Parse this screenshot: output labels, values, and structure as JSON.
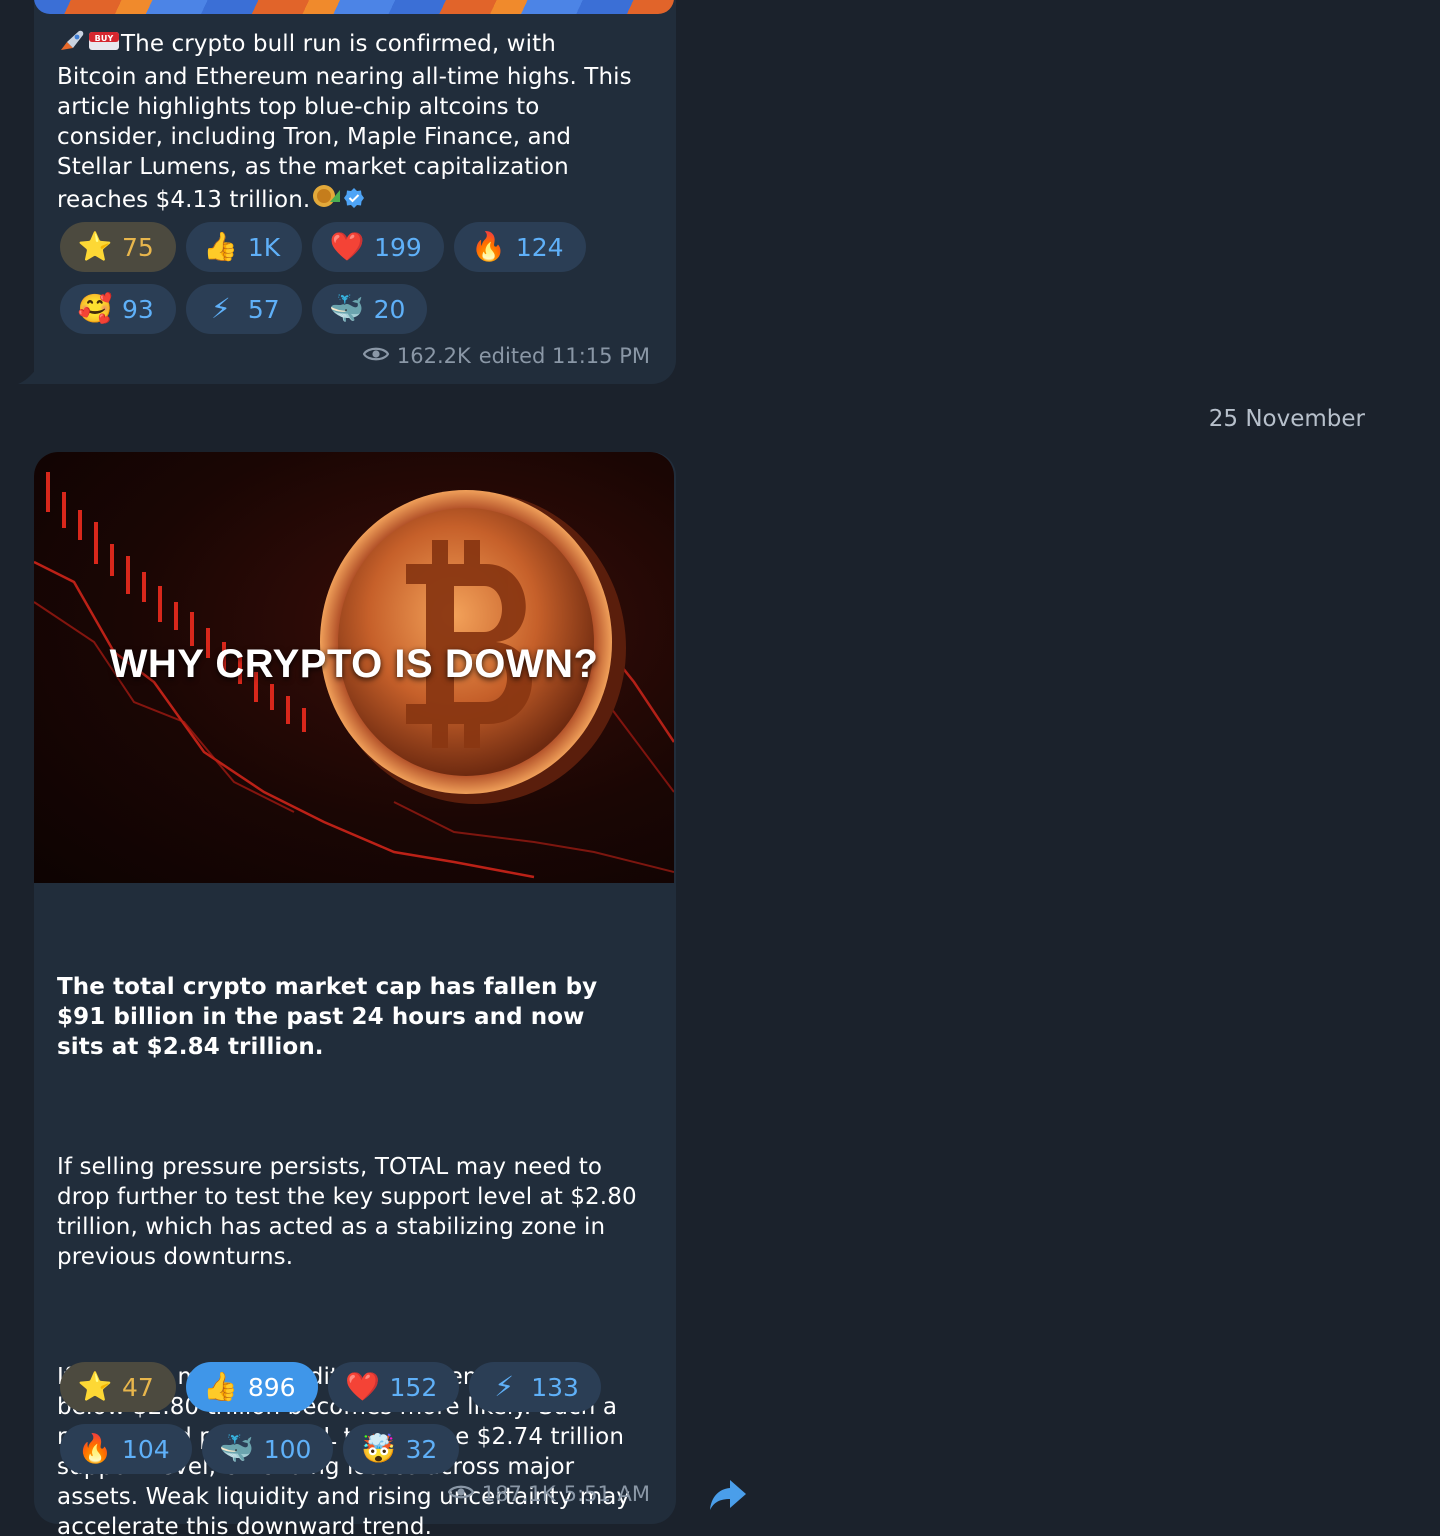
{
  "date_separator": "25 November",
  "messages": [
    {
      "text": "The crypto bull run is confirmed, with Bitcoin and Ethereum nearing all-time highs. This article highlights top blue-chip altcoins to consider, including Tron, Maple Finance, and Stellar Lumens, as the market capitalization reaches $4.13 trillion.",
      "reactions_row1": [
        {
          "icon": "star-icon",
          "count": "75",
          "style": "paid"
        },
        {
          "icon": "thumbs-up-icon",
          "count": "1K",
          "style": "normal"
        },
        {
          "icon": "heart-icon",
          "count": "199",
          "style": "normal"
        },
        {
          "icon": "fire-icon",
          "count": "124",
          "style": "normal"
        }
      ],
      "reactions_row2": [
        {
          "icon": "smiling-face-with-hearts-icon",
          "count": "93",
          "style": "normal"
        },
        {
          "icon": "lightning-icon",
          "count": "57",
          "style": "normal"
        },
        {
          "icon": "whale-icon",
          "count": "20",
          "style": "normal"
        }
      ],
      "views": "162.2K",
      "time": "edited 11:15 PM"
    },
    {
      "image_caption": "WHY CRYPTO IS DOWN?",
      "headline": "The total crypto market cap has fallen by $91 billion in the past 24 hours and now sits at $2.84 trillion.",
      "paragraph_1": "If selling pressure persists, TOTAL may need to drop further to test the key support level at $2.80 trillion, which has acted as a stabilizing zone in previous downturns.",
      "paragraph_2": "If broader market conditions worsen, a decline below $2.80 trillion becomes more likely. Such a move could push TOTAL toward the $2.74 trillion support level, extending losses across major assets. Weak liquidity and rising uncertainty may accelerate this downward trend.",
      "reactions_row1": [
        {
          "icon": "star-icon",
          "count": "47",
          "style": "paid"
        },
        {
          "icon": "thumbs-up-icon",
          "count": "896",
          "style": "active"
        },
        {
          "icon": "heart-icon",
          "count": "152",
          "style": "normal"
        },
        {
          "icon": "lightning-icon",
          "count": "133",
          "style": "normal"
        }
      ],
      "reactions_row2": [
        {
          "icon": "fire-icon",
          "count": "104",
          "style": "normal"
        },
        {
          "icon": "whale-icon",
          "count": "100",
          "style": "normal"
        },
        {
          "icon": "exploding-head-icon",
          "count": "32",
          "style": "normal"
        }
      ],
      "views": "187.1K",
      "time": "5:51 AM"
    }
  ],
  "colors": {
    "background": "#1b222c",
    "bubble": "#212d3b",
    "reaction_bg": "#2b3e55",
    "reaction_text": "#5fb0f8",
    "paid_reaction_bg": "#4c4a3f",
    "active_reaction_bg": "#3f96e9",
    "meta_text": "#8a97a6"
  }
}
